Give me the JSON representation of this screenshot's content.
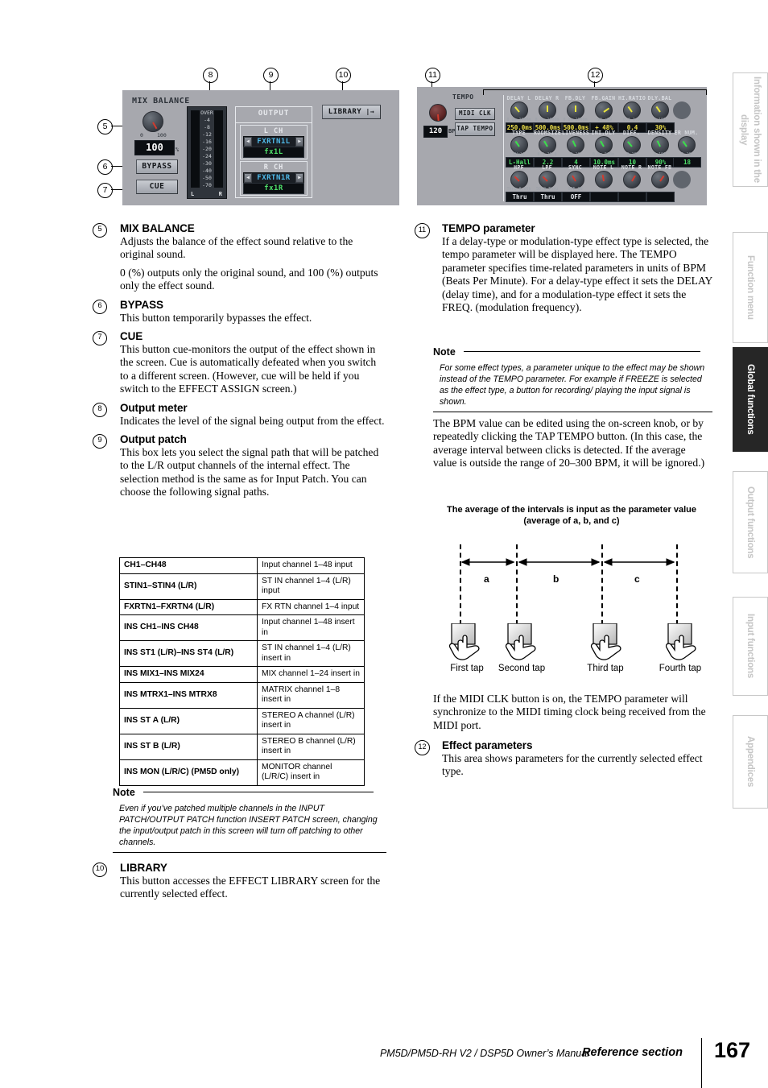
{
  "figure_left": {
    "mix_balance_label": "MIX BALANCE",
    "knob_min": "0",
    "knob_max": "100",
    "value": "100",
    "unit": "%",
    "bypass_label": "BYPASS",
    "cue_label": "CUE",
    "meter_scale": [
      "OVER",
      "-4",
      "-8",
      "-12",
      "-16",
      "-20",
      "-24",
      "-30",
      "-40",
      "-50",
      "-70"
    ],
    "meter_left_label": "L",
    "meter_right_label": "R",
    "output_title": "OUTPUT",
    "channels": [
      {
        "name": "L CH",
        "patch": "FXRTN1L",
        "label": "fx1L"
      },
      {
        "name": "R CH",
        "patch": "FXRTN1R",
        "label": "fx1R"
      }
    ],
    "library_label": "LIBRARY",
    "library_arrow": "←→",
    "callouts": [
      "5",
      "6",
      "7",
      "8",
      "9",
      "10"
    ]
  },
  "figure_right": {
    "tempo_label": "TEMPO",
    "bpm_value": "120",
    "bpm_unit": "BPM",
    "midi_clk_label": "MIDI CLK",
    "tap_tempo_label": "TAP TEMPO",
    "callouts": [
      "11",
      "12"
    ],
    "params_row1": [
      {
        "label": "DELAY L",
        "min": "0.0m",
        "max": "1000m",
        "value": "250.0ms",
        "color": "yellow"
      },
      {
        "label": "DELAY R",
        "min": "0.0m",
        "max": "1000m",
        "value": "500.0ms",
        "color": "yellow"
      },
      {
        "label": "FB.DLY",
        "min": "0.0m",
        "max": "1000m",
        "value": "500.0ms",
        "color": "yellow"
      },
      {
        "label": "FB.GAIN",
        "min": "-99",
        "max": "+99",
        "value": "+  48%",
        "color": "yellow"
      },
      {
        "label": "HI.RATIO",
        "min": "0.1",
        "max": "1.0",
        "value": "0.4",
        "color": "yellow"
      },
      {
        "label": "DLY.BAL",
        "min": "0",
        "max": "100",
        "value": "30%",
        "color": "yellow"
      }
    ],
    "params_row2": [
      {
        "label": "TYPE",
        "min": "SHall",
        "max": "Spring",
        "value": "L-Hall",
        "color": "green"
      },
      {
        "label": "ROOMSIZE",
        "min": "0.1",
        "max": "20.0",
        "value": "2.2",
        "color": "green"
      },
      {
        "label": "LIVENESS",
        "min": "0",
        "max": "10",
        "value": "4",
        "color": "green"
      },
      {
        "label": "INI.DLY",
        "min": "0.0m",
        "max": "500m",
        "value": "10.0ms",
        "color": "green"
      },
      {
        "label": "DIFF.",
        "min": "0",
        "max": "10",
        "value": "10",
        "color": "green"
      },
      {
        "label": "DENSITY",
        "min": "0",
        "max": "100",
        "value": "90%",
        "color": "green"
      },
      {
        "label": "ER NUM.",
        "min": "1",
        "max": "19",
        "value": "18",
        "color": "green"
      }
    ],
    "params_row3": [
      {
        "label": "HPF",
        "min": "Thru",
        "max": "8.00k",
        "value": "Thru",
        "color": "white"
      },
      {
        "label": "LPF",
        "min": "50.0",
        "max": "Thru",
        "value": "Thru",
        "color": "white"
      },
      {
        "label": "SYNC",
        "min": "OFF",
        "max": "ON",
        "value": "OFF",
        "color": "white"
      },
      {
        "label": "NOTE L",
        "min": "----",
        "max": "",
        "value": "",
        "color": "white"
      },
      {
        "label": "NOTE R",
        "min": "----",
        "max": "",
        "value": "",
        "color": "white"
      },
      {
        "label": "NOTE FB",
        "min": "----",
        "max": "",
        "value": "",
        "color": "white"
      }
    ]
  },
  "left_column": {
    "items": [
      {
        "num": "5",
        "heading": "MIX BALANCE",
        "paras": [
          "Adjusts the balance of the effect sound relative to the original sound.",
          "0 (%) outputs only the original sound, and 100 (%) outputs only the effect sound."
        ]
      },
      {
        "num": "6",
        "heading": "BYPASS",
        "paras": [
          "This button temporarily bypasses the effect."
        ]
      },
      {
        "num": "7",
        "heading": "CUE",
        "paras": [
          "This button cue-monitors the output of the effect shown in the screen. Cue is automatically defeated when you switch to a different screen. (However, cue will be held if you switch to the EFFECT ASSIGN screen.)"
        ]
      },
      {
        "num": "8",
        "heading": "Output meter",
        "paras": [
          "Indicates the level of the signal being output from the effect."
        ]
      },
      {
        "num": "9",
        "heading": "Output patch",
        "paras": [
          "This box lets you select the signal path that will be patched to the L/R output channels of the internal effect. The selection method is the same as for Input Patch. You can choose the following signal paths."
        ]
      }
    ],
    "signal_table": [
      {
        "path": "CH1–CH48",
        "desc": "Input channel 1–48 input"
      },
      {
        "path": "STIN1–STIN4 (L/R)",
        "desc": "ST IN channel 1–4 (L/R) input"
      },
      {
        "path": "FXRTN1–FXRTN4 (L/R)",
        "desc": "FX RTN channel 1–4 input"
      },
      {
        "path": "INS CH1–INS CH48",
        "desc": "Input channel 1–48 insert in"
      },
      {
        "path": "INS ST1 (L/R)–INS ST4 (L/R)",
        "desc": "ST IN channel 1–4 (L/R) insert in"
      },
      {
        "path": "INS MIX1–INS MIX24",
        "desc": "MIX channel 1–24 insert in"
      },
      {
        "path": "INS MTRX1–INS MTRX8",
        "desc": "MATRIX channel 1–8 insert in"
      },
      {
        "path": "INS ST A (L/R)",
        "desc": "STEREO A channel (L/R) insert in"
      },
      {
        "path": "INS ST B (L/R)",
        "desc": "STEREO B channel (L/R) insert in"
      },
      {
        "path": "INS MON (L/R/C) (PM5D only)",
        "desc": "MONITOR channel (L/R/C) insert in"
      }
    ],
    "note": {
      "heading": "Note",
      "body": "Even if you’ve patched multiple channels in the INPUT PATCH/OUTPUT PATCH function INSERT PATCH screen, changing the input/output patch in this screen will turn off patching to other channels."
    },
    "item10": {
      "num": "10",
      "heading": "LIBRARY",
      "paras": [
        "This button accesses the EFFECT LIBRARY screen for the currently selected effect."
      ]
    }
  },
  "right_column": {
    "item11": {
      "num": "11",
      "heading": "TEMPO parameter",
      "paras": [
        "If a delay-type or modulation-type effect type is selected, the tempo parameter will be displayed here. The TEMPO parameter specifies time-related parameters in units of BPM (Beats Per Minute). For a delay-type effect it sets the DELAY (delay time), and for a modulation-type effect it sets the FREQ. (modulation frequency)."
      ]
    },
    "note": {
      "heading": "Note",
      "body": "For some effect types, a parameter unique to the effect may be shown instead of the TEMPO parameter. For example if FREEZE is selected as the effect type, a button for recording/ playing the input signal is shown."
    },
    "para_after_note": "The BPM value can be edited using the on-screen knob, or by repeatedly clicking the TAP TEMPO button. (In this case, the average interval between clicks is detected. If the average value is outside the range of 20–300 BPM, it will be ignored.)",
    "tap_diagram": {
      "caption": "The average of the intervals is input as the parameter value (average of a, b, and c)",
      "intervals": [
        "a",
        "b",
        "c"
      ],
      "taps": [
        "First tap",
        "Second tap",
        "Third tap",
        "Fourth tap"
      ]
    },
    "para_midi": "If the MIDI CLK button is on, the TEMPO parameter will synchronize to the MIDI timing clock being received from the MIDI port.",
    "item12": {
      "num": "12",
      "heading": "Effect parameters",
      "paras": [
        "This area shows parameters for the currently selected effect type."
      ]
    }
  },
  "side_tabs": [
    {
      "label": "Information shown in the display",
      "active": false
    },
    {
      "label": "Function menu",
      "active": false
    },
    {
      "label": "Global functions",
      "active": true
    },
    {
      "label": "Output functions",
      "active": false
    },
    {
      "label": "Input functions",
      "active": false
    },
    {
      "label": "Appendices",
      "active": false
    }
  ],
  "footer": {
    "manual": "PM5D/PM5D-RH V2 / DSP5D Owner’s Manual",
    "section": "Reference section",
    "page": "167"
  }
}
